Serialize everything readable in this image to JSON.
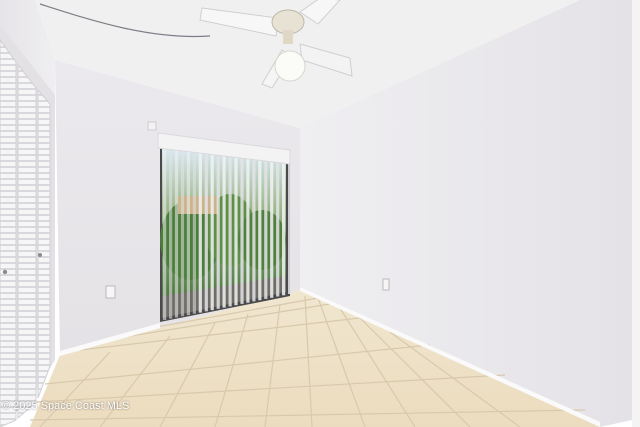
{
  "photo": {
    "subject": "empty room with ceiling fan, sliding glass door with vertical blinds, louvered closet doors and tile floor",
    "colors": {
      "wall": "#ecebee",
      "wall_shadow": "#dcdadd",
      "ceiling": "#f1f0f1",
      "floor_tile": "#efe2c8",
      "grout": "#d8c9ad",
      "baseboard": "#fafafa",
      "blinds": "#e9e9ec",
      "foliage": "#4c7d3b",
      "sky": "#dceaf5"
    }
  },
  "watermark": {
    "text": "© 2025 Space Coast MLS"
  }
}
